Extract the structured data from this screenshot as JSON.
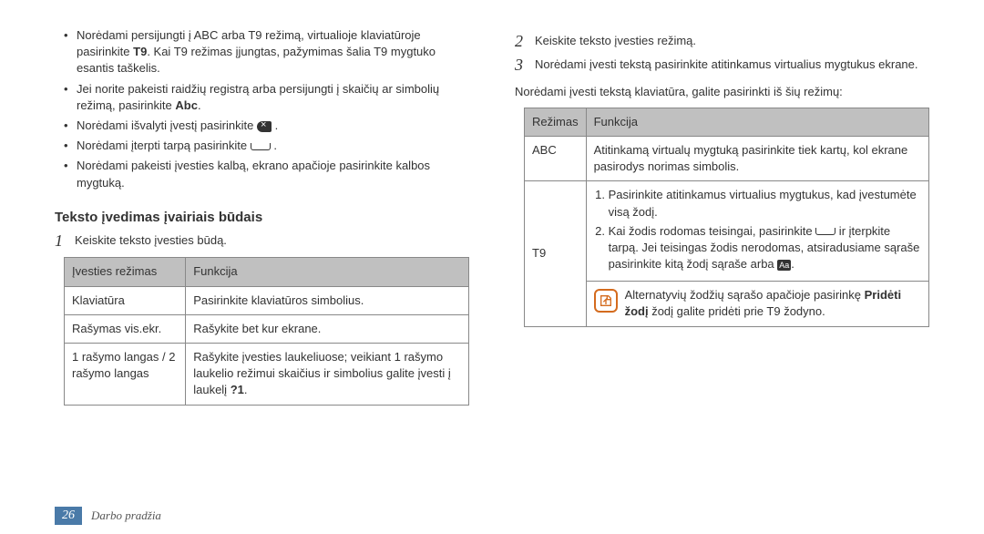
{
  "left": {
    "bullets": [
      {
        "pre": "Norėdami persijungti į ABC arba T9 režimą, virtualioje klaviatūroje pasirinkite ",
        "bold": "T9",
        "post": ". Kai T9 režimas įjungtas, pažymimas šalia T9 mygtuko esantis taškelis."
      },
      {
        "pre": "Jei norite pakeisti raidžių registrą arba persijungti į skaičių ar simbolių režimą, pasirinkite ",
        "bold": "Abc",
        "post": "."
      },
      {
        "pre": "Norėdami išvalyti įvestį pasirinkite ",
        "icon": "clear",
        "post": " ."
      },
      {
        "pre": "Norėdami įterpti tarpą pasirinkite ",
        "icon": "space",
        "post": " ."
      },
      {
        "pre": "Norėdami pakeisti įvesties kalbą, ekrano apačioje pasirinkite kalbos mygtuką."
      }
    ],
    "subhead": "Teksto įvedimas įvairiais būdais",
    "step1": "Keiskite teksto įvesties būdą.",
    "table": {
      "headers": [
        "Įvesties režimas",
        "Funkcija"
      ],
      "rows": [
        [
          "Klaviatūra",
          "Pasirinkite klaviatūros simbolius."
        ],
        [
          "Rašymas vis.ekr.",
          "Rašykite bet kur ekrane."
        ],
        [
          "1 rašymo langas / 2 rašymo langas",
          "Rašykite įvesties laukeliuose; veikiant 1 rašymo laukelio režimui skaičius ir simbolius galite įvesti į laukelį ?1."
        ]
      ]
    }
  },
  "right": {
    "step2": "Keiskite teksto įvesties režimą.",
    "step3": "Norėdami įvesti tekstą pasirinkite atitinkamus virtualius mygtukus ekrane.",
    "intro": "Norėdami įvesti tekstą klaviatūra, galite pasirinkti iš šių režimų:",
    "table": {
      "headers": [
        "Režimas",
        "Funkcija"
      ],
      "abc_label": "ABC",
      "abc_text": "Atitinkamą virtualų mygtuką pasirinkite tiek kartų, kol ekrane pasirodys norimas simbolis.",
      "t9_label": "T9",
      "t9_li1": "Pasirinkite atitinkamus virtualius mygtukus, kad įvestumėte visą žodį.",
      "t9_li2_a": "Kai žodis rodomas teisingai, pasirinkite ",
      "t9_li2_b": " ir įterpkite tarpą. Jei teisingas žodis nerodomas, atsiradusiame sąraše pasirinkite kitą žodį sąraše arba ",
      "t9_li2_c": ".",
      "note_a": "Alternatyvių žodžių sąrašo apačioje pasirinkę ",
      "note_bold": "Pridėti žodį",
      "note_b": " žodį galite pridėti prie T9 žodyno."
    }
  },
  "footer": {
    "page": "26",
    "section": "Darbo pradžia"
  }
}
